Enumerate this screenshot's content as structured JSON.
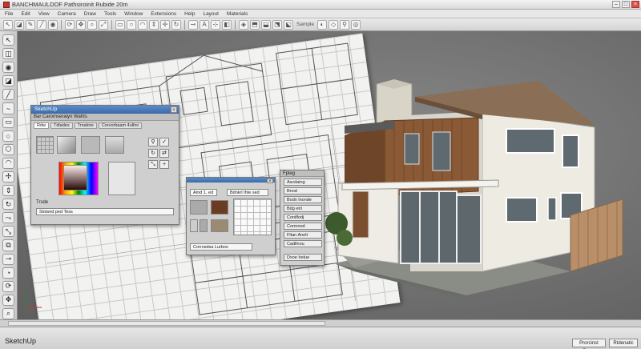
{
  "window": {
    "title": "BANCHMAULDOF Pathsiroinit Rubide 20m"
  },
  "menu": [
    "File",
    "Edit",
    "View",
    "Camera",
    "Draw",
    "Tools",
    "Window",
    "Extensions",
    "Help",
    "Layout",
    "Materials"
  ],
  "toolbar": {
    "label": "Sample"
  },
  "panels": {
    "main": {
      "title": "SketchUp",
      "subtitle": "Bar Caromseraiyn Wahts",
      "tabs": [
        "Rdw",
        "Tdlades",
        "Trnalore",
        "Crevorbaam 4ullno"
      ],
      "text_label": "Trsde",
      "dropdown_value": "Slotsnd ped Tess"
    },
    "textures": {
      "header_field": "Amd 1. ed",
      "header_field2": "Bdnkrl Ihte sed",
      "footer_field": "Corrosdsa Lurbos"
    },
    "styles": {
      "title": "Fpleg",
      "items": [
        "Ascdaing",
        "Bnod",
        "Bodn lnonde",
        "Bdg etrl",
        "Coniflodj",
        "Comrnod",
        "Fltan Anelt",
        "Cadilnou"
      ],
      "footer": "Dxoe Irelue"
    }
  },
  "bottom": {
    "app_name": "SketchUp",
    "buttons": [
      "Prorcinst Rowe",
      "Rtdenatic"
    ]
  },
  "colors": {
    "accent": "#3b6aa8",
    "wood": "#8a5a36",
    "wall": "#eeebe3"
  }
}
